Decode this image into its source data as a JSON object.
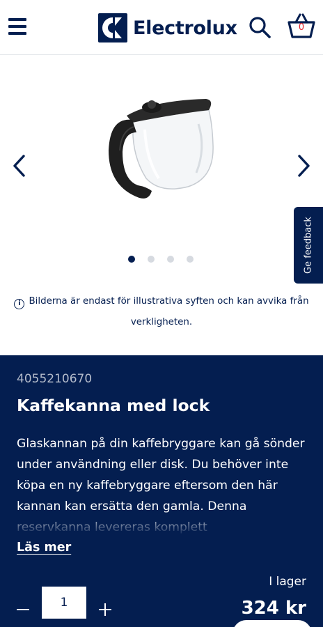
{
  "header": {
    "brand": "Electrolux",
    "cart_count": "0"
  },
  "gallery": {
    "dots_total": 4,
    "active_dot": 1,
    "disclaimer": "Bilderna är endast för illustrativa syften och kan avvika från verkligheten."
  },
  "feedback": {
    "label": "Ge feedback"
  },
  "product": {
    "sku": "4055210670",
    "title": "Kaffekanna med lock",
    "description": "Glaskannan på din kaffebryggare kan gå sönder under användning eller disk. Du behöver inte köpa en ny kaffebryggare eftersom den här kannan kan ersätta den gamla. Denna reservkanna levereras komplett",
    "read_more": "Läs mer",
    "stock_status": "I lager",
    "quantity": "1",
    "price": "324 kr"
  },
  "colors": {
    "brand_navy": "#041e50",
    "cart_count_red": "#e4252c"
  }
}
